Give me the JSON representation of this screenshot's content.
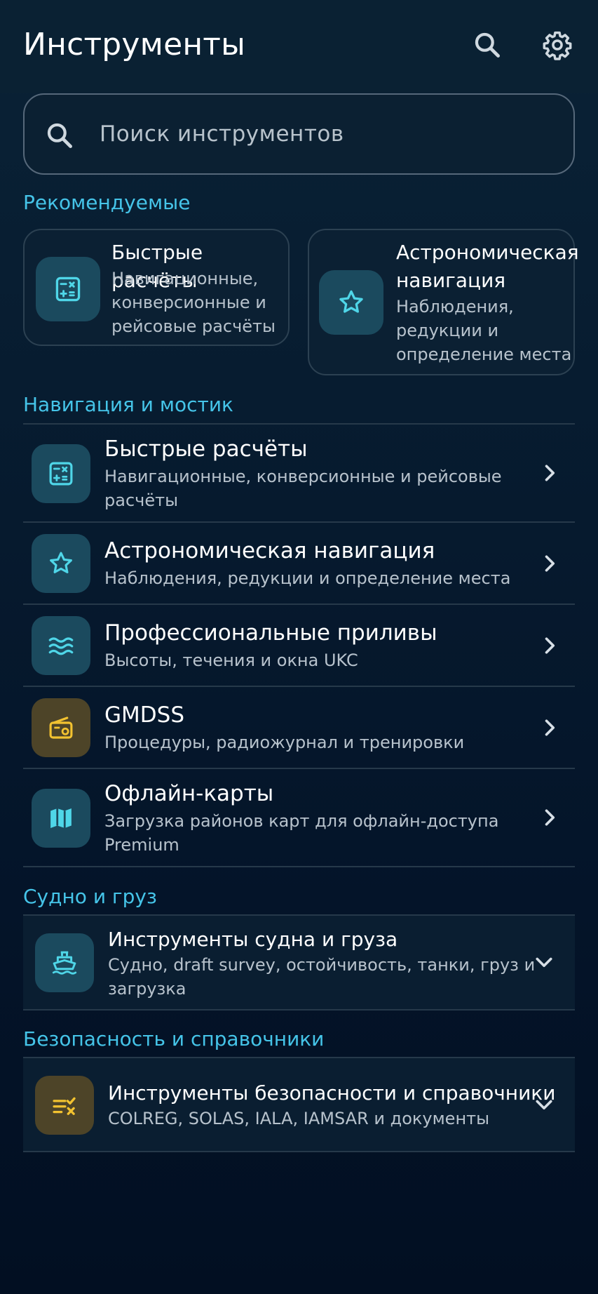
{
  "header": {
    "title": "Инструменты",
    "search_icon": "search-icon",
    "settings_icon": "gear-icon"
  },
  "search": {
    "placeholder": "Поиск инструментов"
  },
  "featured": {
    "title": "Рекомендуемые",
    "cards": [
      {
        "title": "Быстрые расчёты",
        "subtitle": [
          "Навигационные,",
          "конверсионные и",
          "рейсовые расчёты"
        ],
        "icon": "calculator-icon"
      },
      {
        "title": [
          "Астрономическая",
          "навигация"
        ],
        "subtitle": [
          "Наблюдения,",
          "редукции и",
          "определение места"
        ],
        "icon": "star-icon"
      }
    ]
  },
  "nav": {
    "title": "Навигация и мостик",
    "items": [
      {
        "title": "Быстрые расчёты",
        "subtitle": [
          "Навигационные, конверсионные и рейсовые",
          "расчёты"
        ],
        "icon": "calculator-icon"
      },
      {
        "title": "Астрономическая навигация",
        "subtitle": [
          "Наблюдения, редукции и определение места"
        ],
        "icon": "star-icon"
      },
      {
        "title": "Профессиональные приливы",
        "subtitle": [
          "Высоты, течения и окна UKC"
        ],
        "icon": "waves-icon"
      },
      {
        "title": "GMDSS",
        "subtitle": [
          "Процедуры, радиожурнал и тренировки"
        ],
        "icon": "radio-icon"
      },
      {
        "title": "Офлайн-карты",
        "subtitle": [
          "Загрузка районов карт для офлайн-доступа",
          "Premium"
        ],
        "icon": "map-icon"
      }
    ]
  },
  "ship": {
    "title": "Судно и груз",
    "group": {
      "title": "Инструменты судна и груза",
      "subtitle": [
        "Судно, draft survey, остойчивость, танки, груз и",
        "загрузка"
      ],
      "icon": "ship-icon"
    }
  },
  "safety": {
    "title": "Безопасность и справочники",
    "group": {
      "title": "Инструменты безопасности и справочники",
      "subtitle": [
        "COLREG, SOLAS, IALA, IAMSAR и документы"
      ],
      "icon": "checklist-icon"
    }
  },
  "colors": {
    "accent": "#45c4e8",
    "icon_teal": "#4fd6e8",
    "icon_gold": "#f2c230",
    "background": "#03142a"
  }
}
